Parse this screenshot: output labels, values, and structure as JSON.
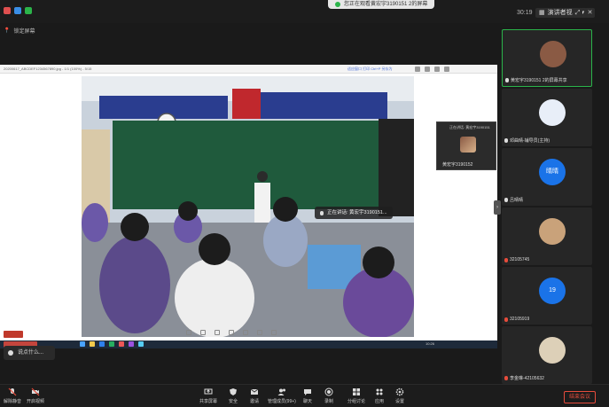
{
  "topbar": {
    "share_status": "您正在观看黄宏宇3190151 2的屏幕",
    "timer": "30:19",
    "view_label": "演讲者视图",
    "view_chevron": "▾",
    "win_buttons": [
      "⤢",
      "✕"
    ]
  },
  "lock_label": "锁定屏幕",
  "shared_screen": {
    "viewer_title": "20200617_ABCDEF1234567890.jpg - 1/1 (100%) - 5/15",
    "viewer_right": "适应窗口 打印 Ctrl+P 另存为",
    "pip": {
      "title": "正在讲话: 黄宏宇3190151",
      "name": "黄宏宇3190152"
    },
    "speaking": "正在讲话: 黄宏宇3190151...",
    "speaking_icon": "mic-icon",
    "taskbar_time": "10:26"
  },
  "chat_placeholder": "说点什么...",
  "side_handle_glyph": "›",
  "participants": [
    {
      "name": "黄宏宇3190151 2的屏幕共享",
      "avatar_color": "#8a5a44",
      "avatar_text": "",
      "active": true,
      "mic": "on"
    },
    {
      "name": "邓曲晴-辅导员(主持)",
      "avatar_color": "#e8eef8",
      "avatar_text": "",
      "active": false,
      "mic": "on"
    },
    {
      "name": "吕晴晴",
      "avatar_color": "#1a73e8",
      "avatar_text": "晴晴",
      "active": false,
      "mic": "on"
    },
    {
      "name": "32105745",
      "avatar_color": "#c9a27a",
      "avatar_text": "",
      "active": false,
      "mic": "off"
    },
    {
      "name": "32105919",
      "avatar_color": "#1a73e8",
      "avatar_text": "19",
      "active": false,
      "mic": "off"
    },
    {
      "name": "李金琳-42105632",
      "avatar_color": "#ddd0b8",
      "avatar_text": "",
      "active": false,
      "mic": "off"
    }
  ],
  "toolbar": {
    "unmute": "解除静音",
    "video": "开启视频",
    "share": "共享屏幕",
    "security": "安全",
    "invite": "邀请",
    "participants": "管理成员(99+)",
    "chat": "聊天",
    "record": "录制",
    "breakout": "分组讨论",
    "apps": "应用",
    "settings": "设置",
    "end": "结束会议"
  },
  "colors": {
    "accent_green": "#2bb44a",
    "end_red": "#e74c3c",
    "blue_avatar": "#1a73e8"
  }
}
